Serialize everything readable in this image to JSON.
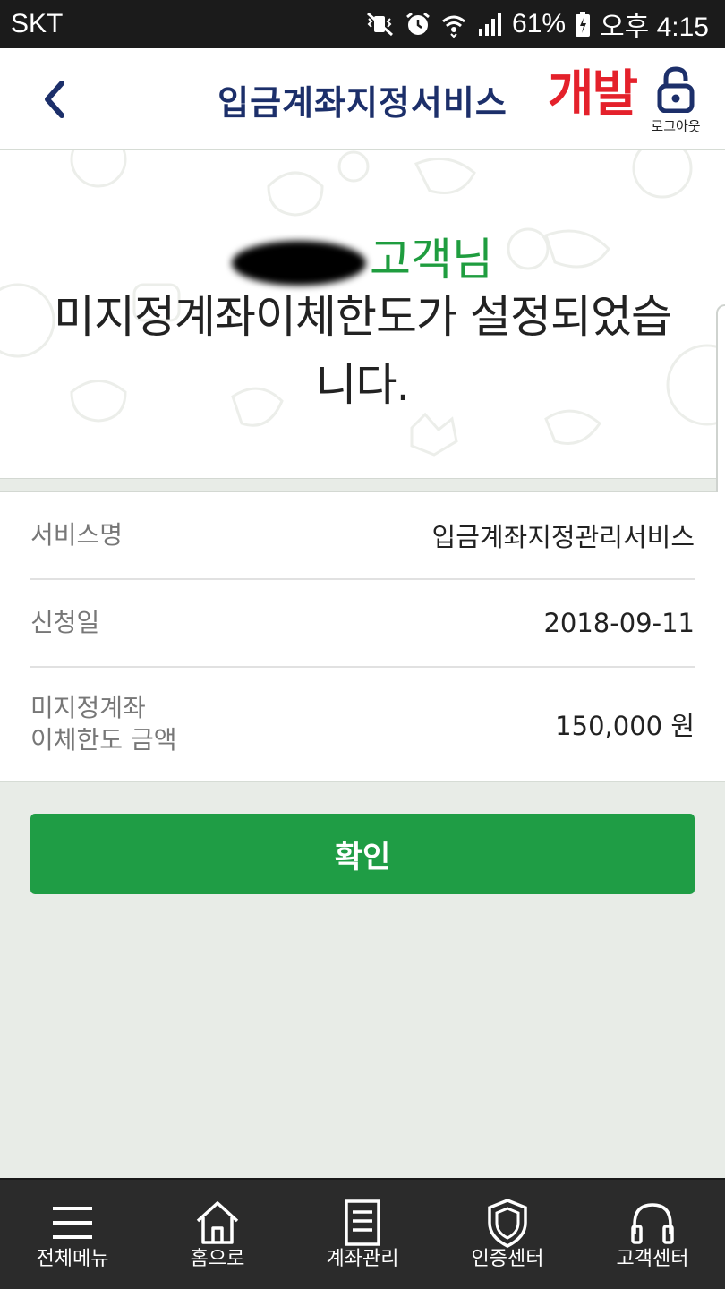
{
  "status_bar": {
    "carrier": "SKT",
    "battery": "61%",
    "time": "오후 4:15",
    "icons": [
      "vibrate-mute-icon",
      "alarm-icon",
      "wifi-icon",
      "signal-icon",
      "battery-icon"
    ]
  },
  "header": {
    "title": "입금계좌지정서비스",
    "dev_badge": "개발",
    "logout_label": "로그아웃",
    "back_icon": "back-arrow-icon",
    "accent_color": "#1c2f6a",
    "badge_color": "#e4212b"
  },
  "hero": {
    "greeting_suffix": "고객님",
    "message": "미지정계좌이체한도가 설정되었습니다.",
    "greeting_color": "#1f9d3f"
  },
  "info": {
    "rows": [
      {
        "label": "서비스명",
        "value": "입금계좌지정관리서비스"
      },
      {
        "label": "신청일",
        "value": "2018-09-11"
      },
      {
        "label_line1": "미지정계좌",
        "label_line2": "이체한도 금액",
        "value": "150,000 원"
      }
    ]
  },
  "confirm": {
    "label": "확인",
    "color": "#1f9d45"
  },
  "bottom_nav": {
    "items": [
      {
        "label": "전체메뉴",
        "icon": "menu-icon"
      },
      {
        "label": "홈으로",
        "icon": "home-icon"
      },
      {
        "label": "계좌관리",
        "icon": "document-icon"
      },
      {
        "label": "인증센터",
        "icon": "shield-icon"
      },
      {
        "label": "고객센터",
        "icon": "headset-icon"
      }
    ]
  }
}
